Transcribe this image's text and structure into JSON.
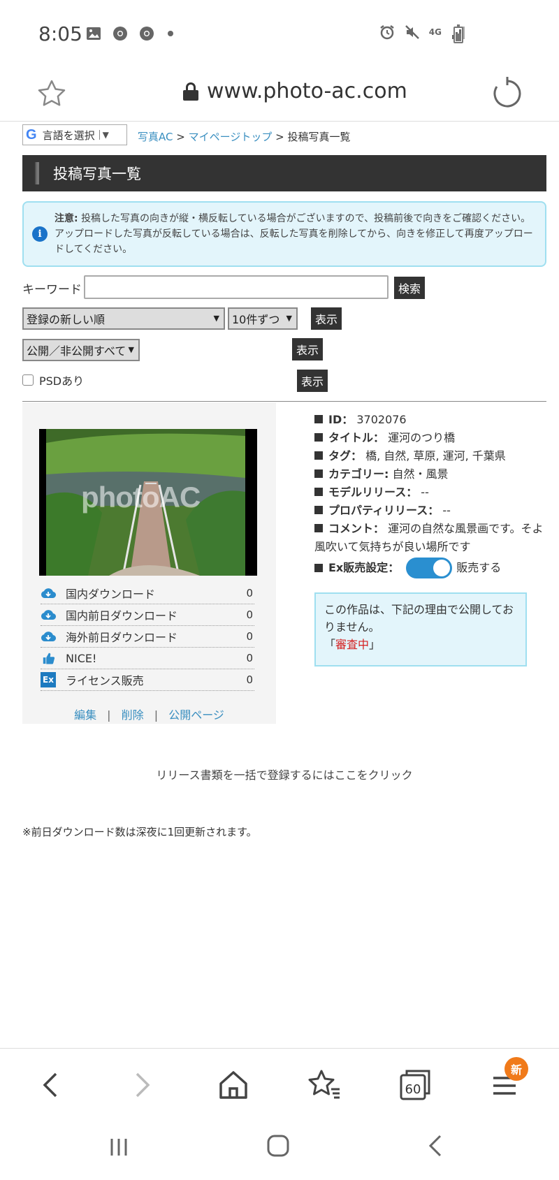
{
  "status_bar": {
    "time": "8:05",
    "network": "4G"
  },
  "browser": {
    "url": "www.photo-ac.com",
    "tab_count": "60",
    "menu_badge": "新"
  },
  "language_selector": {
    "google_mark": "G",
    "label": "言語を選択",
    "arrow": "▼"
  },
  "breadcrumb": {
    "home": "写真AC",
    "mypage": "マイページトップ",
    "separator": ">",
    "current": "投稿写真一覧"
  },
  "page_title": "投稿写真一覧",
  "notice": {
    "label": "注意:",
    "text": "投稿した写真の向きが縦・横反転している場合がございますので、投稿前後で向きをご確認ください。アップロードした写真が反転している場合は、反転した写真を削除してから、向きを修正して再度アップロードしてください。"
  },
  "search": {
    "keyword_label": "キーワード",
    "keyword_value": "",
    "search_button": "検索"
  },
  "filters": {
    "sort_selected": "登録の新しい順",
    "per_page_selected": "10件ずつ",
    "visibility_selected": "公開／非公開すべて",
    "show_button": "表示",
    "psd_label": "PSDあり",
    "psd_checked": false
  },
  "photo": {
    "watermark": "photoAC",
    "stats": [
      {
        "label": "国内ダウンロード",
        "value": "0",
        "icon": "cloud-download-icon"
      },
      {
        "label": "国内前日ダウンロード",
        "value": "0",
        "icon": "cloud-download-icon"
      },
      {
        "label": "海外前日ダウンロード",
        "value": "0",
        "icon": "cloud-download-icon"
      },
      {
        "label": "NICE!",
        "value": "0",
        "icon": "thumbs-up-icon"
      },
      {
        "label": "ライセンス販売",
        "value": "0",
        "icon": "ex-license-icon"
      }
    ],
    "links": {
      "edit": "編集",
      "delete": "削除",
      "public_page": "公開ページ",
      "separator": "|"
    }
  },
  "details": {
    "id_key": "ID：",
    "id_value": "3702076",
    "title_key": "タイトル：",
    "title_value": "運河のつり橋",
    "tags_key": "タグ：",
    "tags_value": "橋, 自然, 草原, 運河, 千葉県",
    "category_key": "カテゴリー:",
    "category_value": "自然・風景",
    "model_release_key": "モデルリリース：",
    "model_release_value": "--",
    "property_release_key": "プロパティリリース：",
    "property_release_value": "--",
    "comment_key": "コメント：",
    "comment_value": "運河の自然な風景画です。そよ風吹いて気持ちが良い場所です",
    "ex_key": "Ex販売設定：",
    "ex_value": "販売する",
    "ex_enabled": true
  },
  "status_box": {
    "line1": "この作品は、下記の理由で公開しておりません。",
    "open_bracket": "「",
    "reason": "審査中",
    "close_bracket": "」"
  },
  "release_link": "リリース書類を一括で登録するにはここをクリック",
  "footnote": "※前日ダウンロード数は深夜に1回更新されます。",
  "colors": {
    "header_bg": "#333333",
    "link": "#3a8fc0",
    "notice_bg": "#e3f5fb",
    "notice_border": "#9fdff0",
    "toggle": "#2a8fd0",
    "reason_red": "#d42020",
    "badge": "#f07a1a"
  }
}
